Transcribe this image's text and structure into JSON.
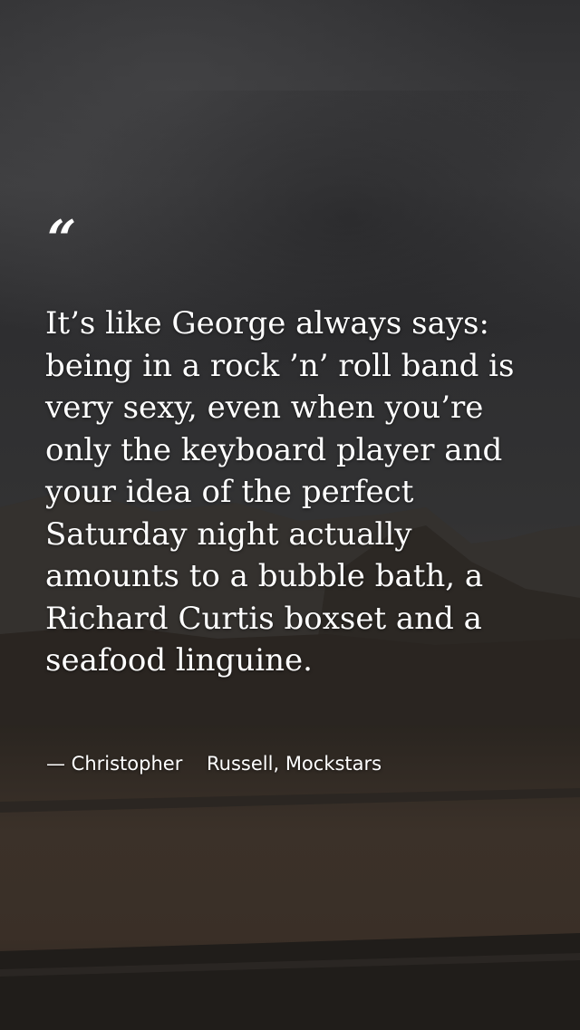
{
  "quote": {
    "mark": "“",
    "text": "It’s like George always says: being in a rock ’n’ roll band is very sexy, even when you’re only the keyboard player and your idea of the perfect Saturday night actually amounts to a bubble bath, a Richard Curtis boxset and a seafood linguine.",
    "attribution": "— Christopher    Russell, Mockstars"
  },
  "colors": {
    "text": "#ffffff",
    "sky": "#3a3a3b",
    "ground": "#3b3129"
  }
}
